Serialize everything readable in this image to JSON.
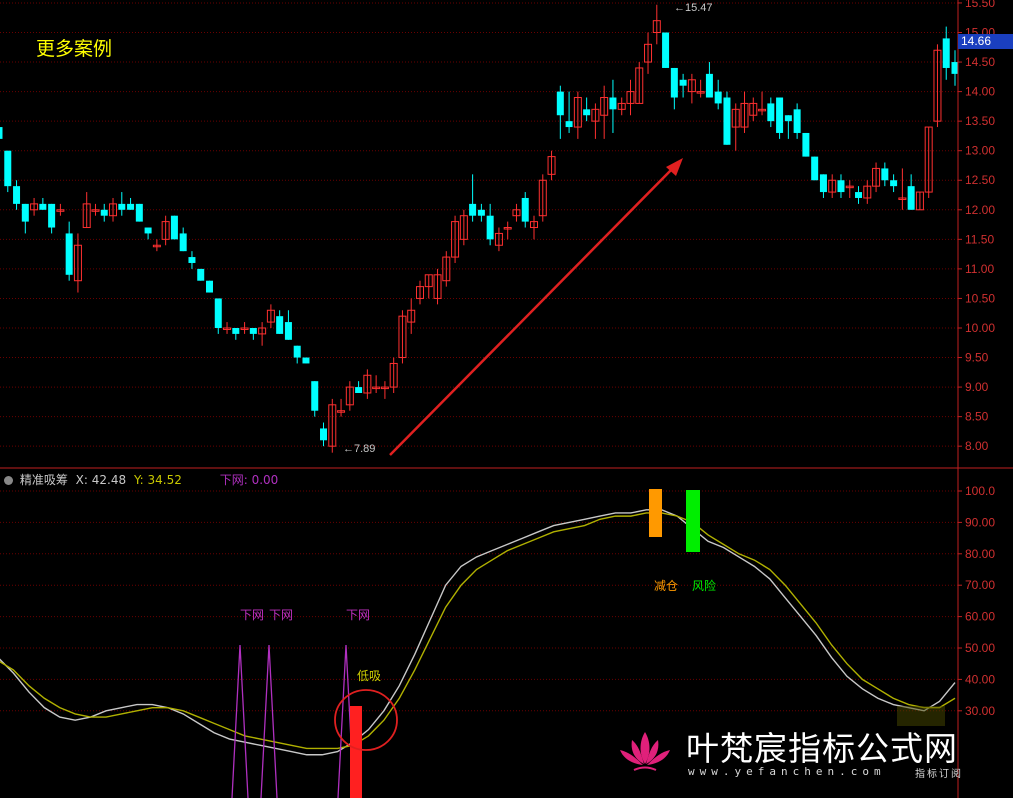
{
  "banner": "更多案例",
  "indicator": {
    "name": "精准吸筹",
    "x_label": "X: 42.48",
    "y_label": "Y: 34.52",
    "signal_label": "下网: 0.00"
  },
  "current_price_tag": "14.66",
  "high_mark": "15.47",
  "low_mark": "7.89",
  "annotations": {
    "down_net": "下网",
    "low_buy": "低吸",
    "reduce": "减仓",
    "risk": "风险"
  },
  "watermark": {
    "main": "叶梵宸指标公式网",
    "url": "www.yefanchen.com",
    "sub": "指标订阅"
  },
  "colors": {
    "up": "#ff3030",
    "down": "#00ffff",
    "axis": "#c02020",
    "grid": "#6a0000",
    "line_x": "#c8c8c8",
    "line_y": "#b0b000",
    "signal": "#b030c0",
    "reduce": "#ff9900",
    "risk": "#00ee00",
    "low_buy": "#ff2020"
  },
  "chart_data": [
    {
      "type": "candlestick",
      "ylim": [
        7.6,
        15.6
      ],
      "y_ticks": [
        "8.00",
        "8.50",
        "9.00",
        "9.50",
        "10.00",
        "10.50",
        "11.00",
        "11.50",
        "12.00",
        "12.50",
        "13.00",
        "13.50",
        "14.00",
        "14.50",
        "15.00",
        "15.50"
      ],
      "ohlc": [
        [
          13.4,
          13.5,
          13.1,
          13.2
        ],
        [
          13.0,
          13.0,
          12.3,
          12.4
        ],
        [
          12.4,
          12.5,
          12.0,
          12.1
        ],
        [
          12.1,
          12.1,
          11.6,
          11.8
        ],
        [
          12.0,
          12.2,
          11.9,
          12.1
        ],
        [
          12.1,
          12.2,
          12.0,
          12.0
        ],
        [
          12.1,
          12.1,
          11.6,
          11.7
        ],
        [
          12.0,
          12.1,
          11.9,
          12.0
        ],
        [
          11.6,
          11.8,
          10.8,
          10.9
        ],
        [
          10.8,
          11.6,
          10.6,
          11.4
        ],
        [
          11.7,
          12.3,
          11.7,
          12.1
        ],
        [
          12.0,
          12.1,
          11.9,
          12.0
        ],
        [
          12.0,
          12.1,
          11.8,
          11.9
        ],
        [
          11.9,
          12.2,
          11.8,
          12.1
        ],
        [
          12.1,
          12.3,
          11.9,
          12.0
        ],
        [
          12.1,
          12.2,
          12.0,
          12.0
        ],
        [
          12.1,
          12.1,
          11.8,
          11.8
        ],
        [
          11.7,
          11.7,
          11.5,
          11.6
        ],
        [
          11.4,
          11.5,
          11.3,
          11.4
        ],
        [
          11.5,
          11.9,
          11.4,
          11.8
        ],
        [
          11.9,
          11.9,
          11.5,
          11.5
        ],
        [
          11.6,
          11.7,
          11.3,
          11.3
        ],
        [
          11.2,
          11.3,
          11.0,
          11.1
        ],
        [
          11.0,
          11.0,
          10.8,
          10.8
        ],
        [
          10.8,
          10.8,
          10.6,
          10.6
        ],
        [
          10.5,
          10.5,
          9.9,
          10.0
        ],
        [
          10.0,
          10.1,
          9.9,
          10.0
        ],
        [
          10.0,
          10.0,
          9.8,
          9.9
        ],
        [
          10.0,
          10.1,
          9.9,
          10.0
        ],
        [
          10.0,
          10.0,
          9.8,
          9.9
        ],
        [
          9.9,
          10.1,
          9.7,
          10.0
        ],
        [
          10.1,
          10.4,
          10.0,
          10.3
        ],
        [
          10.2,
          10.3,
          9.9,
          9.9
        ],
        [
          10.1,
          10.3,
          9.8,
          9.8
        ],
        [
          9.7,
          9.7,
          9.4,
          9.5
        ],
        [
          9.5,
          9.5,
          9.4,
          9.4
        ],
        [
          9.1,
          9.1,
          8.5,
          8.6
        ],
        [
          8.3,
          8.4,
          8.0,
          8.1
        ],
        [
          8.0,
          8.8,
          7.89,
          8.7
        ],
        [
          8.6,
          8.8,
          8.5,
          8.6
        ],
        [
          8.7,
          9.1,
          8.6,
          9.0
        ],
        [
          9.0,
          9.1,
          8.9,
          8.9
        ],
        [
          8.9,
          9.3,
          8.8,
          9.2
        ],
        [
          9.0,
          9.2,
          8.9,
          9.0
        ],
        [
          9.0,
          9.1,
          8.8,
          9.0
        ],
        [
          9.0,
          9.5,
          8.9,
          9.4
        ],
        [
          9.5,
          10.3,
          9.4,
          10.2
        ],
        [
          10.1,
          10.5,
          9.9,
          10.3
        ],
        [
          10.5,
          10.8,
          10.4,
          10.7
        ],
        [
          10.7,
          10.9,
          10.5,
          10.9
        ],
        [
          10.5,
          11.0,
          10.4,
          10.9
        ],
        [
          10.8,
          11.3,
          10.7,
          11.2
        ],
        [
          11.2,
          11.9,
          11.1,
          11.8
        ],
        [
          11.5,
          12.0,
          11.4,
          11.9
        ],
        [
          12.1,
          12.6,
          11.8,
          11.9
        ],
        [
          12.0,
          12.1,
          11.8,
          11.9
        ],
        [
          11.9,
          12.1,
          11.4,
          11.5
        ],
        [
          11.4,
          11.7,
          11.3,
          11.6
        ],
        [
          11.7,
          11.8,
          11.5,
          11.7
        ],
        [
          11.9,
          12.1,
          11.8,
          12.0
        ],
        [
          12.2,
          12.3,
          11.7,
          11.8
        ],
        [
          11.7,
          11.9,
          11.5,
          11.8
        ],
        [
          11.9,
          12.6,
          11.8,
          12.5
        ],
        [
          12.6,
          13.0,
          12.5,
          12.9
        ],
        [
          14.0,
          14.1,
          13.2,
          13.6
        ],
        [
          13.5,
          14.0,
          13.3,
          13.4
        ],
        [
          13.4,
          14.0,
          13.2,
          13.9
        ],
        [
          13.7,
          13.9,
          13.5,
          13.6
        ],
        [
          13.5,
          13.8,
          13.2,
          13.7
        ],
        [
          13.6,
          14.1,
          13.2,
          13.9
        ],
        [
          13.9,
          14.2,
          13.3,
          13.7
        ],
        [
          13.7,
          13.9,
          13.6,
          13.8
        ],
        [
          13.8,
          14.2,
          13.6,
          14.0
        ],
        [
          13.8,
          14.5,
          13.8,
          14.4
        ],
        [
          14.5,
          15.0,
          14.3,
          14.8
        ],
        [
          15.0,
          15.47,
          14.8,
          15.2
        ],
        [
          15.0,
          15.0,
          14.4,
          14.4
        ],
        [
          14.4,
          14.4,
          13.7,
          13.9
        ],
        [
          14.2,
          14.3,
          13.9,
          14.1
        ],
        [
          14.0,
          14.3,
          13.8,
          14.2
        ],
        [
          14.0,
          14.2,
          13.9,
          14.0
        ],
        [
          14.3,
          14.5,
          13.9,
          13.9
        ],
        [
          14.0,
          14.2,
          13.7,
          13.8
        ],
        [
          13.9,
          14.0,
          13.1,
          13.1
        ],
        [
          13.4,
          13.8,
          13.0,
          13.7
        ],
        [
          13.4,
          14.0,
          13.3,
          13.8
        ],
        [
          13.6,
          13.9,
          13.5,
          13.8
        ],
        [
          13.7,
          14.0,
          13.6,
          13.7
        ],
        [
          13.8,
          13.9,
          13.4,
          13.5
        ],
        [
          13.9,
          13.9,
          13.2,
          13.3
        ],
        [
          13.6,
          13.6,
          13.2,
          13.5
        ],
        [
          13.7,
          13.8,
          13.2,
          13.3
        ],
        [
          13.3,
          13.3,
          12.9,
          12.9
        ],
        [
          12.9,
          12.9,
          12.5,
          12.5
        ],
        [
          12.6,
          12.6,
          12.2,
          12.3
        ],
        [
          12.3,
          12.6,
          12.2,
          12.5
        ],
        [
          12.5,
          12.6,
          12.2,
          12.3
        ],
        [
          12.4,
          12.5,
          12.2,
          12.4
        ],
        [
          12.3,
          12.4,
          12.1,
          12.2
        ],
        [
          12.2,
          12.5,
          12.1,
          12.4
        ],
        [
          12.4,
          12.8,
          12.3,
          12.7
        ],
        [
          12.7,
          12.8,
          12.4,
          12.5
        ],
        [
          12.5,
          12.6,
          12.3,
          12.4
        ],
        [
          12.2,
          12.7,
          12.0,
          12.2
        ],
        [
          12.4,
          12.6,
          12.0,
          12.0
        ],
        [
          12.0,
          12.3,
          12.0,
          12.3
        ],
        [
          12.3,
          13.4,
          12.2,
          13.4
        ],
        [
          13.5,
          14.8,
          13.4,
          14.7
        ],
        [
          14.9,
          15.1,
          14.2,
          14.4
        ],
        [
          14.5,
          14.7,
          14.1,
          14.3
        ]
      ]
    },
    {
      "type": "line",
      "ylim": [
        0,
        105
      ],
      "y_ticks": [
        "30.00",
        "40.00",
        "50.00",
        "60.00",
        "70.00",
        "80.00",
        "90.00",
        "100.0"
      ],
      "x_points": [
        0,
        1,
        2,
        3,
        4,
        5,
        6,
        7,
        8,
        9,
        10,
        11,
        12,
        13,
        14,
        15,
        16,
        17,
        18,
        19,
        20,
        21,
        22,
        23,
        24,
        25,
        26,
        27,
        28,
        29,
        30,
        31,
        32,
        33,
        34,
        35,
        36,
        37,
        38,
        39,
        40,
        41,
        42,
        43,
        44,
        45,
        46,
        47,
        48,
        49,
        50,
        51,
        52,
        53,
        54,
        55,
        56,
        57,
        58,
        59,
        60,
        61,
        62,
        63,
        64,
        65
      ],
      "series": [
        {
          "values": [
            47,
            42,
            36,
            31,
            28,
            27,
            28,
            30,
            31,
            32,
            32,
            31,
            29,
            26,
            23,
            21,
            20,
            19,
            18,
            17,
            16,
            16,
            17,
            20,
            24,
            30,
            38,
            48,
            59,
            70,
            76,
            79,
            81,
            83,
            85,
            87,
            89,
            90,
            91,
            92,
            93,
            93,
            94,
            94,
            92,
            88,
            84,
            82,
            79,
            76,
            72,
            66,
            60,
            54,
            47,
            41,
            37,
            34,
            32,
            31,
            30,
            33,
            39
          ]
        },
        {
          "values": [
            46,
            43,
            38,
            34,
            31,
            29,
            28,
            28,
            29,
            30,
            31,
            31,
            30,
            28,
            26,
            24,
            22,
            21,
            20,
            19,
            18,
            18,
            18,
            19,
            22,
            27,
            34,
            43,
            53,
            63,
            70,
            75,
            78,
            81,
            83,
            85,
            87,
            88,
            89,
            91,
            92,
            92,
            93,
            93,
            92,
            90,
            86,
            83,
            80,
            78,
            75,
            70,
            64,
            58,
            51,
            45,
            40,
            37,
            34,
            32,
            31,
            31,
            34
          ]
        }
      ]
    }
  ]
}
